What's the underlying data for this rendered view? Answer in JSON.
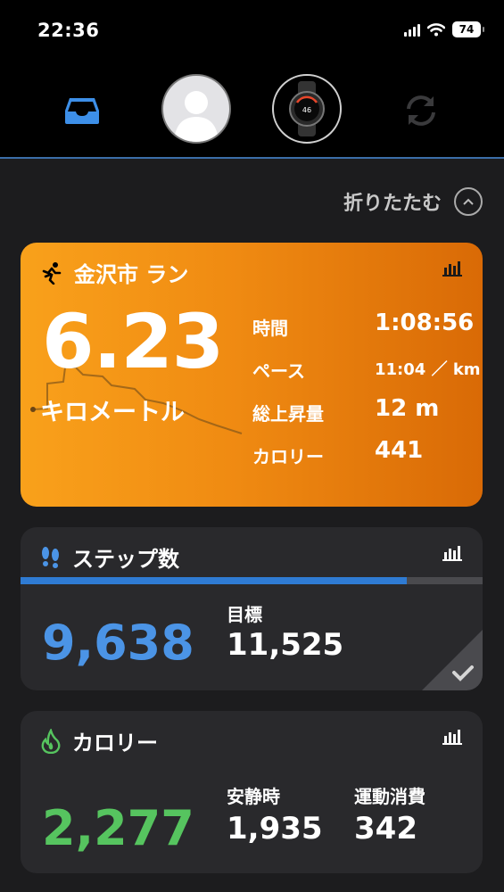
{
  "status": {
    "time": "22:36",
    "battery": "74"
  },
  "header": {
    "collapse_label": "折りたたむ"
  },
  "run": {
    "title": "金沢市 ラン",
    "distance": "6.23",
    "unit": "キロメートル",
    "stats": [
      {
        "label": "時間",
        "value": "1:08:56"
      },
      {
        "label": "ペース",
        "value": "11:04 ／ km"
      },
      {
        "label": "総上昇量",
        "value": "12 m"
      },
      {
        "label": "カロリー",
        "value": "441"
      }
    ]
  },
  "steps": {
    "title": "ステップ数",
    "value": "9,638",
    "goal_label": "目標",
    "goal_value": "11,525",
    "progress": 0.836
  },
  "calories": {
    "title": "カロリー",
    "total": "2,277",
    "resting_label": "安静時",
    "resting_value": "1,935",
    "active_label": "運動消費",
    "active_value": "342"
  },
  "colors": {
    "accent_blue": "#2f7bd3",
    "run_orange": "#f08b12",
    "steps_blue": "#4b94e6",
    "calorie_green": "#56c45f"
  },
  "icons": [
    "inbox-icon",
    "avatar",
    "watch-icon",
    "sync-icon",
    "chevron-up-icon",
    "running-icon",
    "footsteps-icon",
    "flame-icon",
    "bar-chart-icon",
    "checkmark-icon"
  ]
}
